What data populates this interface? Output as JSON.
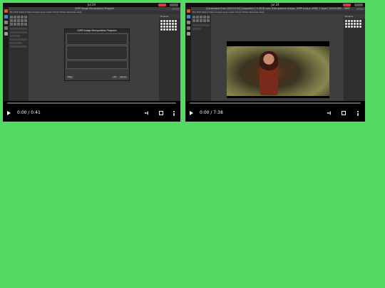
{
  "players": [
    {
      "id": "p1",
      "time": "0:00 / 0:41",
      "window_title": "GIMP Image Manipulation Program",
      "topbar_clock": "Jul 24",
      "dialog_title": "GIMP Image Manipulation Program",
      "dialog_buttons": [
        "Help",
        "OK",
        "Cancel"
      ]
    },
    {
      "id": "p2",
      "time": "0:00 / 7:38",
      "window_title": "[Screenshot from 2023-03-06] (imported)-1.0 (RGB color 8-bit gamma integer, GIMP built-in sRGB, 1 layer) 1920x1080 – GIMP",
      "topbar_clock": "Jul 24"
    }
  ],
  "menu_text": "File  Edit  Select  View  Image  Layer  Colors  Tools  Filters  Windows  Help",
  "colors": {
    "background": "#53da63",
    "recording": "#d13c3c",
    "progress": "#5f5f5f"
  }
}
